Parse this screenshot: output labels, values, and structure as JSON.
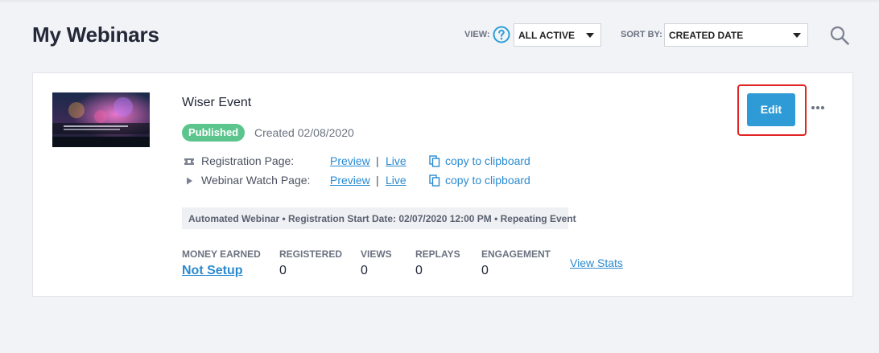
{
  "page": {
    "title": "My Webinars"
  },
  "toolbar": {
    "view_label": "VIEW:",
    "view_select_value": "ALL ACTIVE",
    "sort_label": "SORT BY:",
    "sort_select_value": "CREATED DATE",
    "help_icon": "question-circle-icon",
    "search_icon": "search-icon"
  },
  "webinar": {
    "title": "Wiser Event",
    "status": "Published",
    "created": "Created 02/08/2020",
    "registration_page": {
      "label": "Registration Page:",
      "preview": "Preview",
      "separator": "|",
      "live": "Live",
      "copy": "copy to clipboard"
    },
    "watch_page": {
      "label": "Webinar Watch Page:",
      "preview": "Preview",
      "separator": "|",
      "live": "Live",
      "copy": "copy to clipboard"
    },
    "info": "Automated Webinar • Registration Start Date: 02/07/2020 12:00 PM • Repeating Event",
    "stats": {
      "money_label": "MONEY EARNED",
      "money_value": "Not Setup",
      "registered_label": "REGISTERED",
      "registered_value": "0",
      "views_label": "VIEWS",
      "views_value": "0",
      "replays_label": "REPLAYS",
      "replays_value": "0",
      "engagement_label": "ENGAGEMENT",
      "engagement_value": "0",
      "view_stats": "View Stats"
    },
    "edit_label": "Edit",
    "more_icon": "ellipsis-icon"
  },
  "colors": {
    "accent": "#2f9bd6",
    "link": "#2a8ad0",
    "published": "#5cc58d",
    "highlight": "#e02424"
  }
}
